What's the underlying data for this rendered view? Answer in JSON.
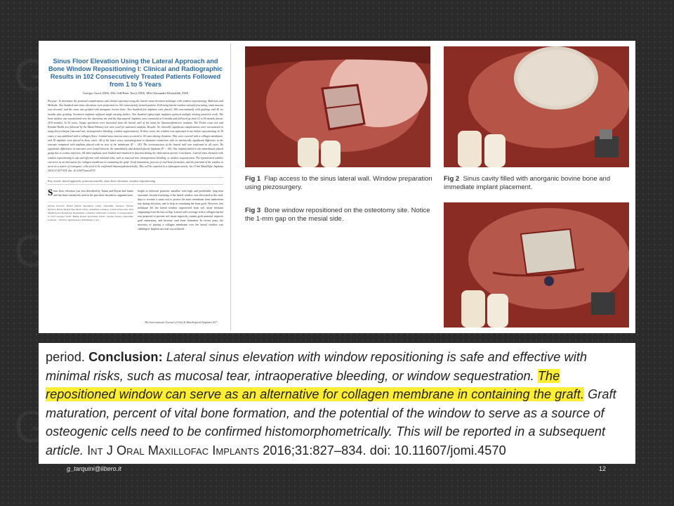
{
  "paper": {
    "title": "Sinus Floor Elevation Using the Lateral Approach and Bone Window Repositioning I: Clinical and Radiographic Results in 102 Consecutively Treated Patients Followed from 1 to 5 Years",
    "authors": "Georges Tawil, DDS, DSc Odf/Peter Tawil, DDS, MSc/Alexandre Khairallah, DDS",
    "abstract": "Purpose: To determine the potential complications and clinical outcomes using the lateral sinus elevation technique with window repositioning. Materials and Methods: One hundred nine sinus elevations were performed on 102 consecutively treated patients. Following lateral window outward fracturing, sinus mucosa was elevated, and the sinus was grafted with anorganic bovine bone. Two hundred five implants were placed; 200 concomitantly with grafting, and 45 six months after grafting. Seventeen implants replaced single missing molars. One hundred eighty-eight implants replaced multiple missing posterior teeth. The bone window was repositioned over the osteotomy site and the flap sutured. Implants were connected at 6 months and followed up from 12 to 60 months (mean: 29.8 months). In 30 cases, biopsy specimens were harvested from the lateral wall of the sinus for histomorphometric analysis. The Fisher exact test and Kruskal-Wallis test followed by the Mann-Whitney test were used for statistical analysis. Results: No clinically significant complications were encountered in using this technique (mucosal tear, intraoperative bleeding, window sequestration). In three cases, the window was separated in two before repositioning. In 30 cases, it was stabilized with a collagen fleece. Limited sinus mucosa tears occurred in 14 cases during elevation. They were covered with a collagen membrane, and 18 implants were placed in these cases. All of the latter cases osseointegrated at abutment connection with no statistically significant difference in the outcome compared with implants placed with no tear of the membrane (P < .05). The reconstruction of the lateral wall was confirmed in all cases. No significant differences in outcomes were found between the immediately and delayed placed implants (P < .05). One implant failed in the immediately placed group due to a sinus infection. All other implants were loaded and remained in function during the observation period. Conclusion: Lateral sinus elevation with window repositioning is safe and effective with minimal risks, such as mucosal tear, intraoperative bleeding, or window sequestration. The repositioned window can serve as an alternative for collagen membrane in containing the graft. Graft maturation, percent of vital bone formation, and the potential of the window to serve as a source of osteogenic cells need to be confirmed histomorphometrically. This will be reported in a subsequent article. Int J Oral Maxillofac Implants 2016;31:827-834. doi: 10.11607/jomi.4570",
    "keywords": "Key words: lateral approach, posterior maxilla, sinus floor elevation, window repositioning",
    "dropcap": "S",
    "col1": "inus floor elevation was first described by Tatum and Boyne and James and has been extensively used in the past three decades to augment bone",
    "col2": "height in deficient posterior maxillae with high and predictable long-term outcomes. Inward fracturing of the lateral window was advocated in the early days to recreate a sinus roof to protect the sinus membrane from inadvertent tear during elevation, and to help in containing the bone graft. However, this technique left the lateral window unprotected from soft tissue invasion originating from the buccal flap. Lateral wall coverage with a collagen barrier was proposed to prevent soft tissue ingrowth, contain graft material, improve graft maturation, and increase vital bone formation. In recent years, the necessity of placing a collagen membrane over the lateral window was challenged. Implant survival was achieved",
    "affiliations": "Private Practice, Beirut Dental Specialists Clinic, Ashrafieh, Lebanon. Private Practice, Beirut Dental Specialists Clinic, Ashrafieh, Lebanon. Clinical Associate, Oral Maxillofacial Radiology Department, Lebanese University, Lebanon. Correspondence to: Prof Georges Tawil, Beirut Dental Specialists Clinic, Sassine Square, Ashrafieh, Lebanon. ©2016 by Quintessence Publishing Co Inc.",
    "footer": "The International Journal of Oral & Maxillofacial Implants 827"
  },
  "figures": [
    {
      "label": "Fig 1",
      "caption": "Flap access to the sinus lateral wall. Window preparation using piezosurgery."
    },
    {
      "label": "Fig 2",
      "caption": "Sinus cavity filled with anorganic bovine bone and immediate implant placement."
    },
    {
      "label": "Fig 3",
      "caption": "Bone window repositioned on the osteotomy site. Notice the 1-mm gap on the mesial side."
    }
  ],
  "conclusion": {
    "lead": "period.",
    "label": "Conclusion:",
    "text1": "Lateral sinus elevation with window repositioning is safe and effective with minimal risks, such as mucosal tear, intraoperative bleeding, or window sequestration.",
    "highlight": "The repositioned window can serve as an alternative for collagen membrane in containing the graft.",
    "text2": "Graft maturation, percent of vital bone formation, and the potential of the window to serve as a source of osteogenic cells need to be confirmed histomorphometrically. This will be reported in a subsequent article.",
    "journal": "Int J Oral Maxillofac Implants",
    "citation": "2016;31:827–834. doi: 10.11607/jomi.4570"
  },
  "footer": {
    "email": "g_tarquini@libero.it",
    "page": "12"
  },
  "colors": {
    "highlight": "#ffee33",
    "title_blue": "#2b6aa6",
    "background": "#2b2b2b"
  }
}
